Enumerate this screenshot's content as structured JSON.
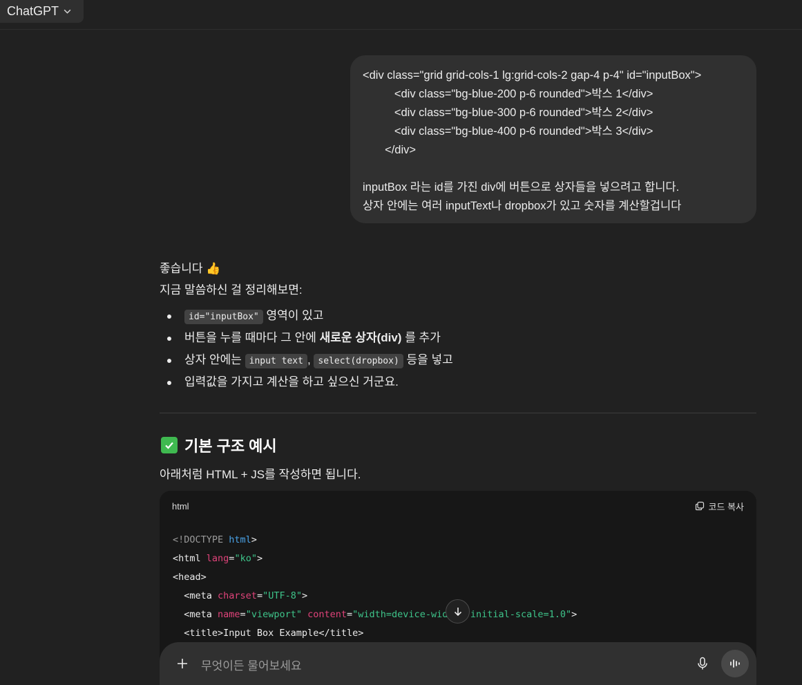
{
  "header": {
    "model_label": "ChatGPT"
  },
  "user_message": {
    "lines": [
      "<div class=\"grid grid-cols-1 lg:grid-cols-2 gap-4 p-4\" id=\"inputBox\">",
      "          <div class=\"bg-blue-200 p-6 rounded\">박스 1</div>",
      "          <div class=\"bg-blue-300 p-6 rounded\">박스 2</div>",
      "          <div class=\"bg-blue-400 p-6 rounded\">박스 3</div>",
      "       </div>",
      "",
      "inputBox 라는 id를 가진 div에 버튼으로 상자들을 넣으려고 합니다.",
      "상자 안에는 여러 inputText나 dropbox가 있고 숫자를 계산할겁니다"
    ]
  },
  "assistant": {
    "greeting": "좋습니다 👍",
    "summary_intro": "지금 말씀하신 걸 정리해보면:",
    "bullets": {
      "b1_code": "id=\"inputBox\"",
      "b1_text": " 영역이 있고",
      "b2_pre": "버튼을 누를 때마다 그 안에 ",
      "b2_bold": "새로운 상자(div)",
      "b2_post": " 를 추가",
      "b3_pre": "상자 안에는 ",
      "b3_code1": "input text",
      "b3_sep": ", ",
      "b3_code2": "select(dropbox)",
      "b3_post": " 등을 넣고",
      "b4": "입력값을 가지고 계산을 하고 싶으신 거군요."
    },
    "section_title": "기본 구조 예시",
    "section_sub": "아래처럼 HTML + JS를 작성하면 됩니다.",
    "code_block": {
      "language": "html",
      "copy_label": "코드 복사",
      "l1_a": "<!DOCTYPE ",
      "l1_b": "html",
      "l1_c": ">",
      "l2_a": "<html ",
      "l2_attr": "lang",
      "l2_eq": "=",
      "l2_val": "\"ko\"",
      "l2_c": ">",
      "l3": "<head>",
      "l4_a": "  <meta ",
      "l4_attr": "charset",
      "l4_eq": "=",
      "l4_val": "\"UTF-8\"",
      "l4_c": ">",
      "l5_a": "  <meta ",
      "l5_attr1": "name",
      "l5_eq1": "=",
      "l5_val1": "\"viewport\"",
      "l5_sp": " ",
      "l5_attr2": "content",
      "l5_eq2": "=",
      "l5_val2": "\"width=device-width, initial-scale=1.0\"",
      "l5_c": ">",
      "l6": "  <title>Input Box Example</title>"
    }
  },
  "composer": {
    "placeholder": "무엇이든 물어보세요"
  },
  "colors": {
    "check_green": "#3fb950",
    "attr_pink": "#e0437a",
    "string_green": "#3ec48a",
    "tag_blue": "#4aa3e8"
  }
}
